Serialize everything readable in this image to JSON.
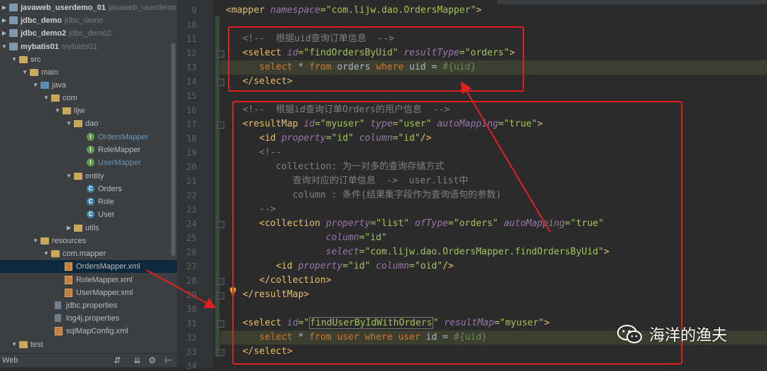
{
  "project_tree": {
    "items": [
      {
        "label": "javaweb_userdemo_01",
        "sub": "javaweb_userdemo"
      },
      {
        "label": "jdbc_demo",
        "sub": "jdbc_demo"
      },
      {
        "label": "jdbc_demo2",
        "sub": "jdbc_demo2"
      },
      {
        "label": "mybatis01",
        "sub": "mybatis01"
      },
      {
        "label": "src"
      },
      {
        "label": "main"
      },
      {
        "label": "java"
      },
      {
        "label": "com"
      },
      {
        "label": "lijw"
      },
      {
        "label": "dao"
      },
      {
        "label": "OrdersMapper"
      },
      {
        "label": "RoleMapper"
      },
      {
        "label": "UserMapper"
      },
      {
        "label": "entity"
      },
      {
        "label": "Orders"
      },
      {
        "label": "Role"
      },
      {
        "label": "User"
      },
      {
        "label": "utils"
      },
      {
        "label": "resources"
      },
      {
        "label": "com.mapper"
      },
      {
        "label": "OrdersMapper.xml"
      },
      {
        "label": "RoleMapper.xml"
      },
      {
        "label": "UserMapper.xml"
      },
      {
        "label": "jdbc.properties"
      },
      {
        "label": "log4j.properties"
      },
      {
        "label": "sqlMapConfig.xml"
      },
      {
        "label": "test"
      }
    ],
    "bottom_label": "Web"
  },
  "editor": {
    "line_numbers": [
      "9",
      "10",
      "11",
      "12",
      "13",
      "14",
      "15",
      "16",
      "17",
      "18",
      "19",
      "20",
      "21",
      "22",
      "23",
      "24",
      "25",
      "26",
      "27",
      "28",
      "29",
      "30",
      "31",
      "32",
      "33",
      "34"
    ],
    "lines": {
      "l9a": "<mapper ",
      "l9b": "namespace",
      "l9c": "=\"com.lijw.dao.OrdersMapper\"",
      "l9d": ">",
      "l11": "<!--  根据uid查询订单信息  -->",
      "l12a": "<select ",
      "l12b": "id",
      "l12c": "=\"findOrdersByUid\" ",
      "l12d": "resultType",
      "l12e": "=\"orders\"",
      "l12f": ">",
      "l13a": "select ",
      "l13b": "* ",
      "l13c": "from ",
      "l13d": "orders ",
      "l13e": "where ",
      "l13f": "uid = ",
      "l13g": "#{uid}",
      "l14": "</select>",
      "l16": "<!--  根据id查询订单Orders的用户信息  -->",
      "l17a": "<resultMap ",
      "l17b": "id",
      "l17c": "=\"myuser\" ",
      "l17d": "type",
      "l17e": "=\"user\" ",
      "l17f": "autoMapping",
      "l17g": "=\"true\"",
      "l17h": ">",
      "l18a": "<id ",
      "l18b": "property",
      "l18c": "=\"id\" ",
      "l18d": "column",
      "l18e": "=\"id\"",
      "l18f": "/>",
      "l19": "<!--",
      "l20": "collection: 为一对多的查询存储方式",
      "l21": "查询对应的订单信息  ->  user.list中",
      "l22": "column : 条件(结果集字段作为查询语句的参数)",
      "l23": "-->",
      "l24a": "<collection ",
      "l24b": "property",
      "l24c": "=\"list\" ",
      "l24d": "ofType",
      "l24e": "=\"orders\" ",
      "l24f": "autoMapping",
      "l24g": "=\"true\"",
      "l25a": "column",
      "l25b": "=\"id\"",
      "l26a": "select",
      "l26b": "=\"com.lijw.dao.OrdersMapper.findOrdersByUid\"",
      "l26c": ">",
      "l27a": "<id ",
      "l27b": "property",
      "l27c": "=\"id\" ",
      "l27d": "column",
      "l27e": "=\"oid\"",
      "l27f": "/>",
      "l28": "</collection>",
      "l29": "</resultMap>",
      "l31a": "<select ",
      "l31b": "id",
      "l31c": "=\"",
      "l31d": "findUserByIdWithOrders",
      "l31e": "\" ",
      "l31f": "resultMap",
      "l31g": "=\"myuser\"",
      "l31h": ">",
      "l32a": "select ",
      "l32b": "* ",
      "l32c": "from ",
      "l32d": "user ",
      "l32e": "where ",
      "l32f": "user ",
      "l32g": "id = ",
      "l32h": "#{uid}",
      "l33": "</select>"
    }
  },
  "watermark": {
    "text": "海洋的渔夫"
  },
  "icons": [
    "folder-icon",
    "module-icon",
    "package-icon",
    "class-icon",
    "interface-icon",
    "xml-file-icon",
    "properties-file-icon",
    "warning-bulb-icon",
    "wechat-icon",
    "gear-icon",
    "collapse-icon"
  ]
}
